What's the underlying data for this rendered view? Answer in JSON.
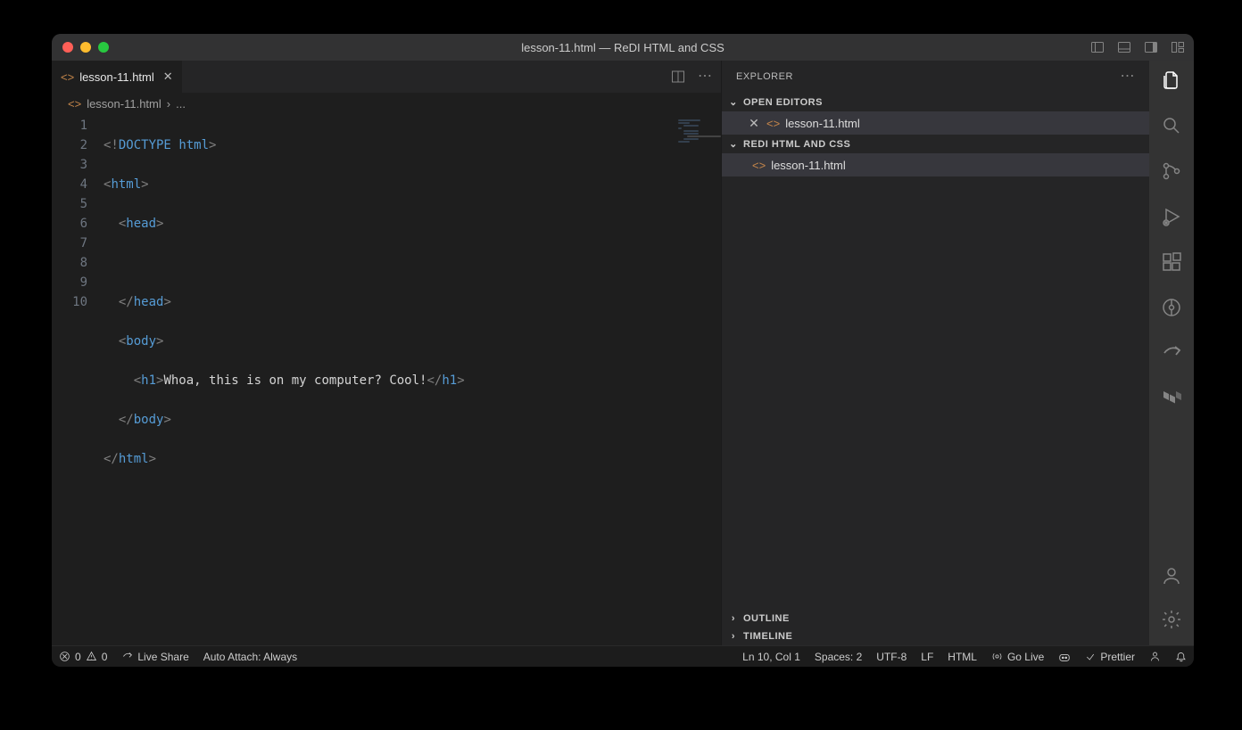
{
  "window": {
    "title": "lesson-11.html — ReDI HTML and CSS"
  },
  "tabs": {
    "active": "lesson-11.html"
  },
  "breadcrumb": {
    "file": "lesson-11.html",
    "sep": "›",
    "rest": "..."
  },
  "gutter": [
    "1",
    "2",
    "3",
    "4",
    "5",
    "6",
    "7",
    "8",
    "9",
    "10"
  ],
  "code": {
    "l1": {
      "p1": "<!",
      "d": "DOCTYPE",
      "sp": " ",
      "h": "html",
      "p2": ">"
    },
    "l2": {
      "o": "<",
      "t": "html",
      "c": ">"
    },
    "l3": {
      "o": "<",
      "t": "head",
      "c": ">"
    },
    "l4": "",
    "l5": {
      "o": "</",
      "t": "head",
      "c": ">"
    },
    "l6": {
      "o": "<",
      "t": "body",
      "c": ">"
    },
    "l7": {
      "o1": "<",
      "t1": "h1",
      "c1": ">",
      "txt": "Whoa, this is on my computer? Cool!",
      "o2": "</",
      "t2": "h1",
      "c2": ">"
    },
    "l8": {
      "o": "</",
      "t": "body",
      "c": ">"
    },
    "l9": {
      "o": "</",
      "t": "html",
      "c": ">"
    }
  },
  "explorer": {
    "title": "EXPLORER",
    "openEditors": "OPEN EDITORS",
    "openFile": "lesson-11.html",
    "project": "REDI HTML AND CSS",
    "file": "lesson-11.html",
    "outline": "OUTLINE",
    "timeline": "TIMELINE"
  },
  "status": {
    "errors": "0",
    "warnings": "0",
    "liveshare": "Live Share",
    "autoattach": "Auto Attach: Always",
    "position": "Ln 10, Col 1",
    "spaces": "Spaces: 2",
    "encoding": "UTF-8",
    "eol": "LF",
    "lang": "HTML",
    "golive": "Go Live",
    "prettier": "Prettier"
  }
}
